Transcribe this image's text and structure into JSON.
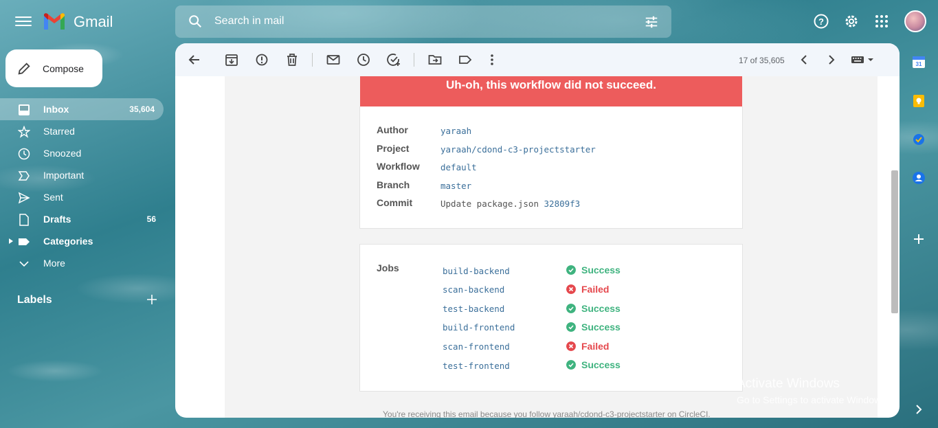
{
  "header": {
    "app_name": "Gmail",
    "search_placeholder": "Search in mail"
  },
  "sidebar": {
    "compose_label": "Compose",
    "items": [
      {
        "label": "Inbox",
        "count": "35,604",
        "icon": "inbox-icon"
      },
      {
        "label": "Starred",
        "count": "",
        "icon": "star-icon"
      },
      {
        "label": "Snoozed",
        "count": "",
        "icon": "clock-icon"
      },
      {
        "label": "Important",
        "count": "",
        "icon": "important-icon"
      },
      {
        "label": "Sent",
        "count": "",
        "icon": "send-icon"
      },
      {
        "label": "Drafts",
        "count": "56",
        "icon": "draft-icon"
      },
      {
        "label": "Categories",
        "count": "",
        "icon": "label-icon"
      },
      {
        "label": "More",
        "count": "",
        "icon": "chevron-down-icon"
      }
    ],
    "labels_title": "Labels"
  },
  "toolbar": {
    "pager": "17 of 35,605"
  },
  "email": {
    "banner": "Uh-oh, this workflow did not succeed.",
    "details": {
      "author_label": "Author",
      "author": "yaraah",
      "project_label": "Project",
      "project": "yaraah/cdond-c3-projectstarter",
      "workflow_label": "Workflow",
      "workflow": "default",
      "branch_label": "Branch",
      "branch": "master",
      "commit_label": "Commit",
      "commit_msg": "Update package.json",
      "commit_hash": "32809f3"
    },
    "jobs_label": "Jobs",
    "jobs": [
      {
        "name": "build-backend",
        "status": "Success"
      },
      {
        "name": "scan-backend",
        "status": "Failed"
      },
      {
        "name": "test-backend",
        "status": "Success"
      },
      {
        "name": "build-frontend",
        "status": "Success"
      },
      {
        "name": "scan-frontend",
        "status": "Failed"
      },
      {
        "name": "test-frontend",
        "status": "Success"
      }
    ],
    "footer": "You're receiving this email because you follow yaraah/cdond-c3-projectstarter on CircleCI."
  },
  "watermark": {
    "line1": "Activate Windows",
    "line2": "Go to Settings to activate Windows."
  },
  "colors": {
    "success": "#3fb37f",
    "failed": "#e5484d",
    "banner": "#ed5c5c",
    "link": "#3b6f9a"
  }
}
